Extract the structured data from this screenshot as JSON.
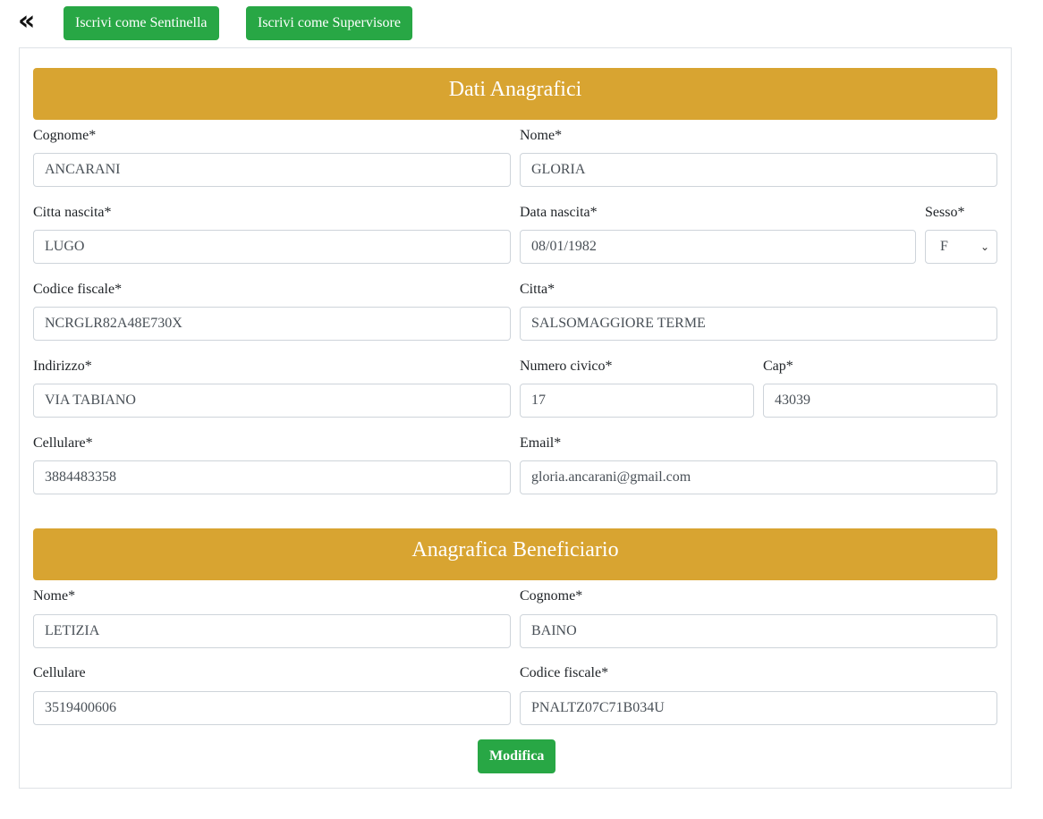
{
  "nav": {
    "back_glyph": "«",
    "btn_sentinella": "Iscrivi come Sentinella",
    "btn_supervisore": "Iscrivi come Supervisore"
  },
  "sections": {
    "anagrafici_title": "Dati Anagrafici",
    "beneficiario_title": "Anagrafica Beneficiario"
  },
  "anagrafici": {
    "cognome": {
      "label": "Cognome*",
      "value": "ANCARANI"
    },
    "nome": {
      "label": "Nome*",
      "value": "GLORIA"
    },
    "citta_nascita": {
      "label": "Citta nascita*",
      "value": "LUGO"
    },
    "data_nascita": {
      "label": "Data nascita*",
      "value": "08/01/1982"
    },
    "sesso": {
      "label": "Sesso*",
      "value": "F"
    },
    "codice_fiscale": {
      "label": "Codice fiscale*",
      "value": "NCRGLR82A48E730X"
    },
    "citta": {
      "label": "Citta*",
      "value": "SALSOMAGGIORE TERME"
    },
    "indirizzo": {
      "label": "Indirizzo*",
      "value": "VIA TABIANO"
    },
    "numero_civico": {
      "label": "Numero civico*",
      "value": "17"
    },
    "cap": {
      "label": "Cap*",
      "value": "43039"
    },
    "cellulare": {
      "label": "Cellulare*",
      "value": "3884483358"
    },
    "email": {
      "label": "Email*",
      "value": "gloria.ancarani@gmail.com"
    }
  },
  "beneficiario": {
    "nome": {
      "label": "Nome*",
      "value": "LETIZIA"
    },
    "cognome": {
      "label": "Cognome*",
      "value": "BAINO"
    },
    "cellulare": {
      "label": "Cellulare",
      "value": "3519400606"
    },
    "codice_fiscale": {
      "label": "Codice fiscale*",
      "value": "PNALTZ07C71B034U"
    }
  },
  "actions": {
    "submit_label": "Modifica"
  },
  "colors": {
    "header_gold": "#d8a431",
    "button_green": "#28a745"
  }
}
